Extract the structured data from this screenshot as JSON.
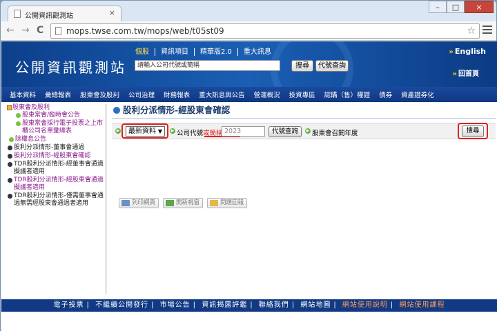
{
  "browser": {
    "tab_title": "公開資訊觀測站",
    "tab_close": "×",
    "window_controls": [
      "–",
      "□",
      "×"
    ],
    "back": "←",
    "forward": "→",
    "reload": "C",
    "url": "mops.twse.com.tw/mops/web/t05st09",
    "star": "☆"
  },
  "banner": {
    "logo": "公開資訊觀測站",
    "links": [
      "個股",
      "資訊項目",
      "精華版2.0",
      "重大訊息"
    ],
    "search_placeholder": "請輸入公司代號或簡稱",
    "search_button": "搜尋",
    "code_button": "代號查詢",
    "english": "English",
    "home": "回首頁",
    "arrows": "»"
  },
  "menu": {
    "items": [
      "基本資料",
      "彙總報表",
      "股東會及股利",
      "公司治理",
      "財務報表",
      "重大訊息與公告",
      "營運概況",
      "投資專區",
      "認購（售）權證",
      "債券",
      "資產證券化"
    ]
  },
  "sidebar": {
    "root": "股東會及股利",
    "items": [
      {
        "label": "股東常會/臨時會公告",
        "style": "purple",
        "icon": "leaf"
      },
      {
        "label": "股東常會採行電子投票之上市櫃公司名單彙總表",
        "style": "purple",
        "icon": "leaf"
      },
      {
        "label": "除權息公告",
        "style": "purple",
        "icon": "leaf"
      },
      {
        "label": "股利分派情形-董事會通過",
        "style": "dark",
        "icon": "dot"
      },
      {
        "label": "股利分派情形-經股東會確認",
        "style": "purple",
        "icon": "dot"
      },
      {
        "label": "TDR股利分派情形-經董事會通過擬議者適用",
        "style": "dark",
        "icon": "dot"
      },
      {
        "label": "TDR股利分派情形-經股東會通過擬議者適用",
        "style": "purple",
        "icon": "dot"
      },
      {
        "label": "TDR股利分派情形-僅需董事會通過無需經股東會通過者適用",
        "style": "dark",
        "icon": "dot"
      }
    ]
  },
  "content": {
    "title": "股利分派情形-經股東會確認",
    "query": {
      "select_value": "最新資料",
      "code_label": "公司代號",
      "code_label_red": "或簡稱",
      "year_placeholder": "2023",
      "code_query_button": "代號查詢",
      "year_label": "股東會召開年度",
      "search_button": "搜尋"
    },
    "actions": [
      "列印網頁",
      "開新視窗",
      "問題回報"
    ]
  },
  "footer": {
    "links": [
      "電子投票",
      "不繼續公開發行",
      "市場公告",
      "資訊揭露評鑑",
      "聯絡我們",
      "網站地圖"
    ],
    "highlight_links": [
      "網站使用說明",
      "網站使用課程"
    ]
  },
  "colors": {
    "banner": "#1a5fb4",
    "menubar": "#0f3781",
    "footer": "#123a84",
    "highlight_ring": "#d22222",
    "link_purple": "#8a1a8a"
  }
}
